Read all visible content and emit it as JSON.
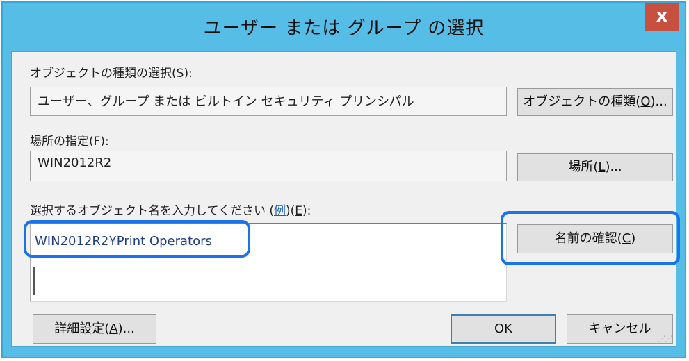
{
  "window": {
    "title": "ユーザー または グループ の選択",
    "close_label": "x"
  },
  "object_types": {
    "label_prefix": "オブジェクトの種類の選択(",
    "label_key": "S",
    "label_suffix": "):",
    "value": "ユーザー、グループ または ビルトイン セキュリティ プリンシパル",
    "button_prefix": "オブジェクトの種類(",
    "button_key": "O",
    "button_suffix": ")..."
  },
  "location": {
    "label_prefix": "場所の指定(",
    "label_key": "F",
    "label_suffix": "):",
    "value": "WIN2012R2",
    "button_prefix": "場所(",
    "button_key": "L",
    "button_suffix": ")..."
  },
  "object_names": {
    "label_prefix": "選択するオブジェクト名を入力してください (",
    "example_link": "例",
    "label_middle": ")(",
    "label_key": "E",
    "label_suffix": "):",
    "entry": "WIN2012R2¥Print Operators",
    "check_button_prefix": "名前の確認(",
    "check_button_key": "C",
    "check_button_suffix": ")"
  },
  "footer": {
    "advanced_prefix": "詳細設定(",
    "advanced_key": "A",
    "advanced_suffix": ")...",
    "ok": "OK",
    "cancel": "キャンセル"
  },
  "colors": {
    "title_bar": "#56bde6",
    "close_button": "#c7503f",
    "highlight": "#1a73e8"
  }
}
